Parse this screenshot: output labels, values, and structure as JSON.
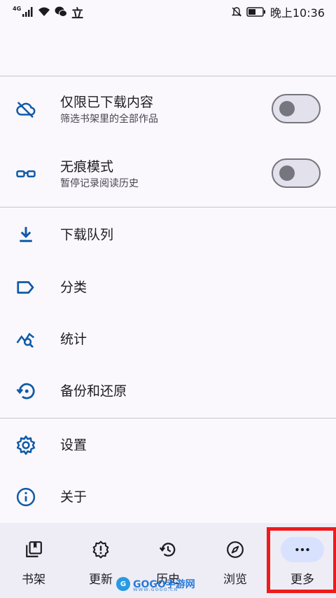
{
  "status_bar": {
    "network": "4G",
    "carrier_glyph": "立",
    "time": "晚上10:36"
  },
  "toggles": [
    {
      "title": "仅限已下载内容",
      "subtitle": "筛选书架里的全部作品",
      "icon": "cloud-off-icon",
      "on": false
    },
    {
      "title": "无痕模式",
      "subtitle": "暂停记录阅读历史",
      "icon": "glasses-icon",
      "on": false
    }
  ],
  "menu": [
    {
      "label": "下载队列",
      "icon": "download-icon"
    },
    {
      "label": "分类",
      "icon": "label-icon"
    },
    {
      "label": "统计",
      "icon": "query-stats-icon"
    },
    {
      "label": "备份和还原",
      "icon": "restore-icon"
    },
    {
      "label": "设置",
      "icon": "gear-icon"
    },
    {
      "label": "关于",
      "icon": "info-icon"
    }
  ],
  "bottom_nav": [
    {
      "label": "书架",
      "icon": "library-icon",
      "active": false
    },
    {
      "label": "更新",
      "icon": "new-release-icon",
      "active": false
    },
    {
      "label": "历史",
      "icon": "history-icon",
      "active": false
    },
    {
      "label": "浏览",
      "icon": "compass-icon",
      "active": false
    },
    {
      "label": "更多",
      "icon": "more-horiz-icon",
      "active": true
    }
  ],
  "watermark": {
    "brand": "GOGO手游网",
    "url": "WWW.GOGO.CN"
  },
  "colors": {
    "accent": "#0f5aa8",
    "highlight": "#ef1b1b",
    "nav_bg": "#eeedf6",
    "active_pill": "#d8e2ff"
  }
}
